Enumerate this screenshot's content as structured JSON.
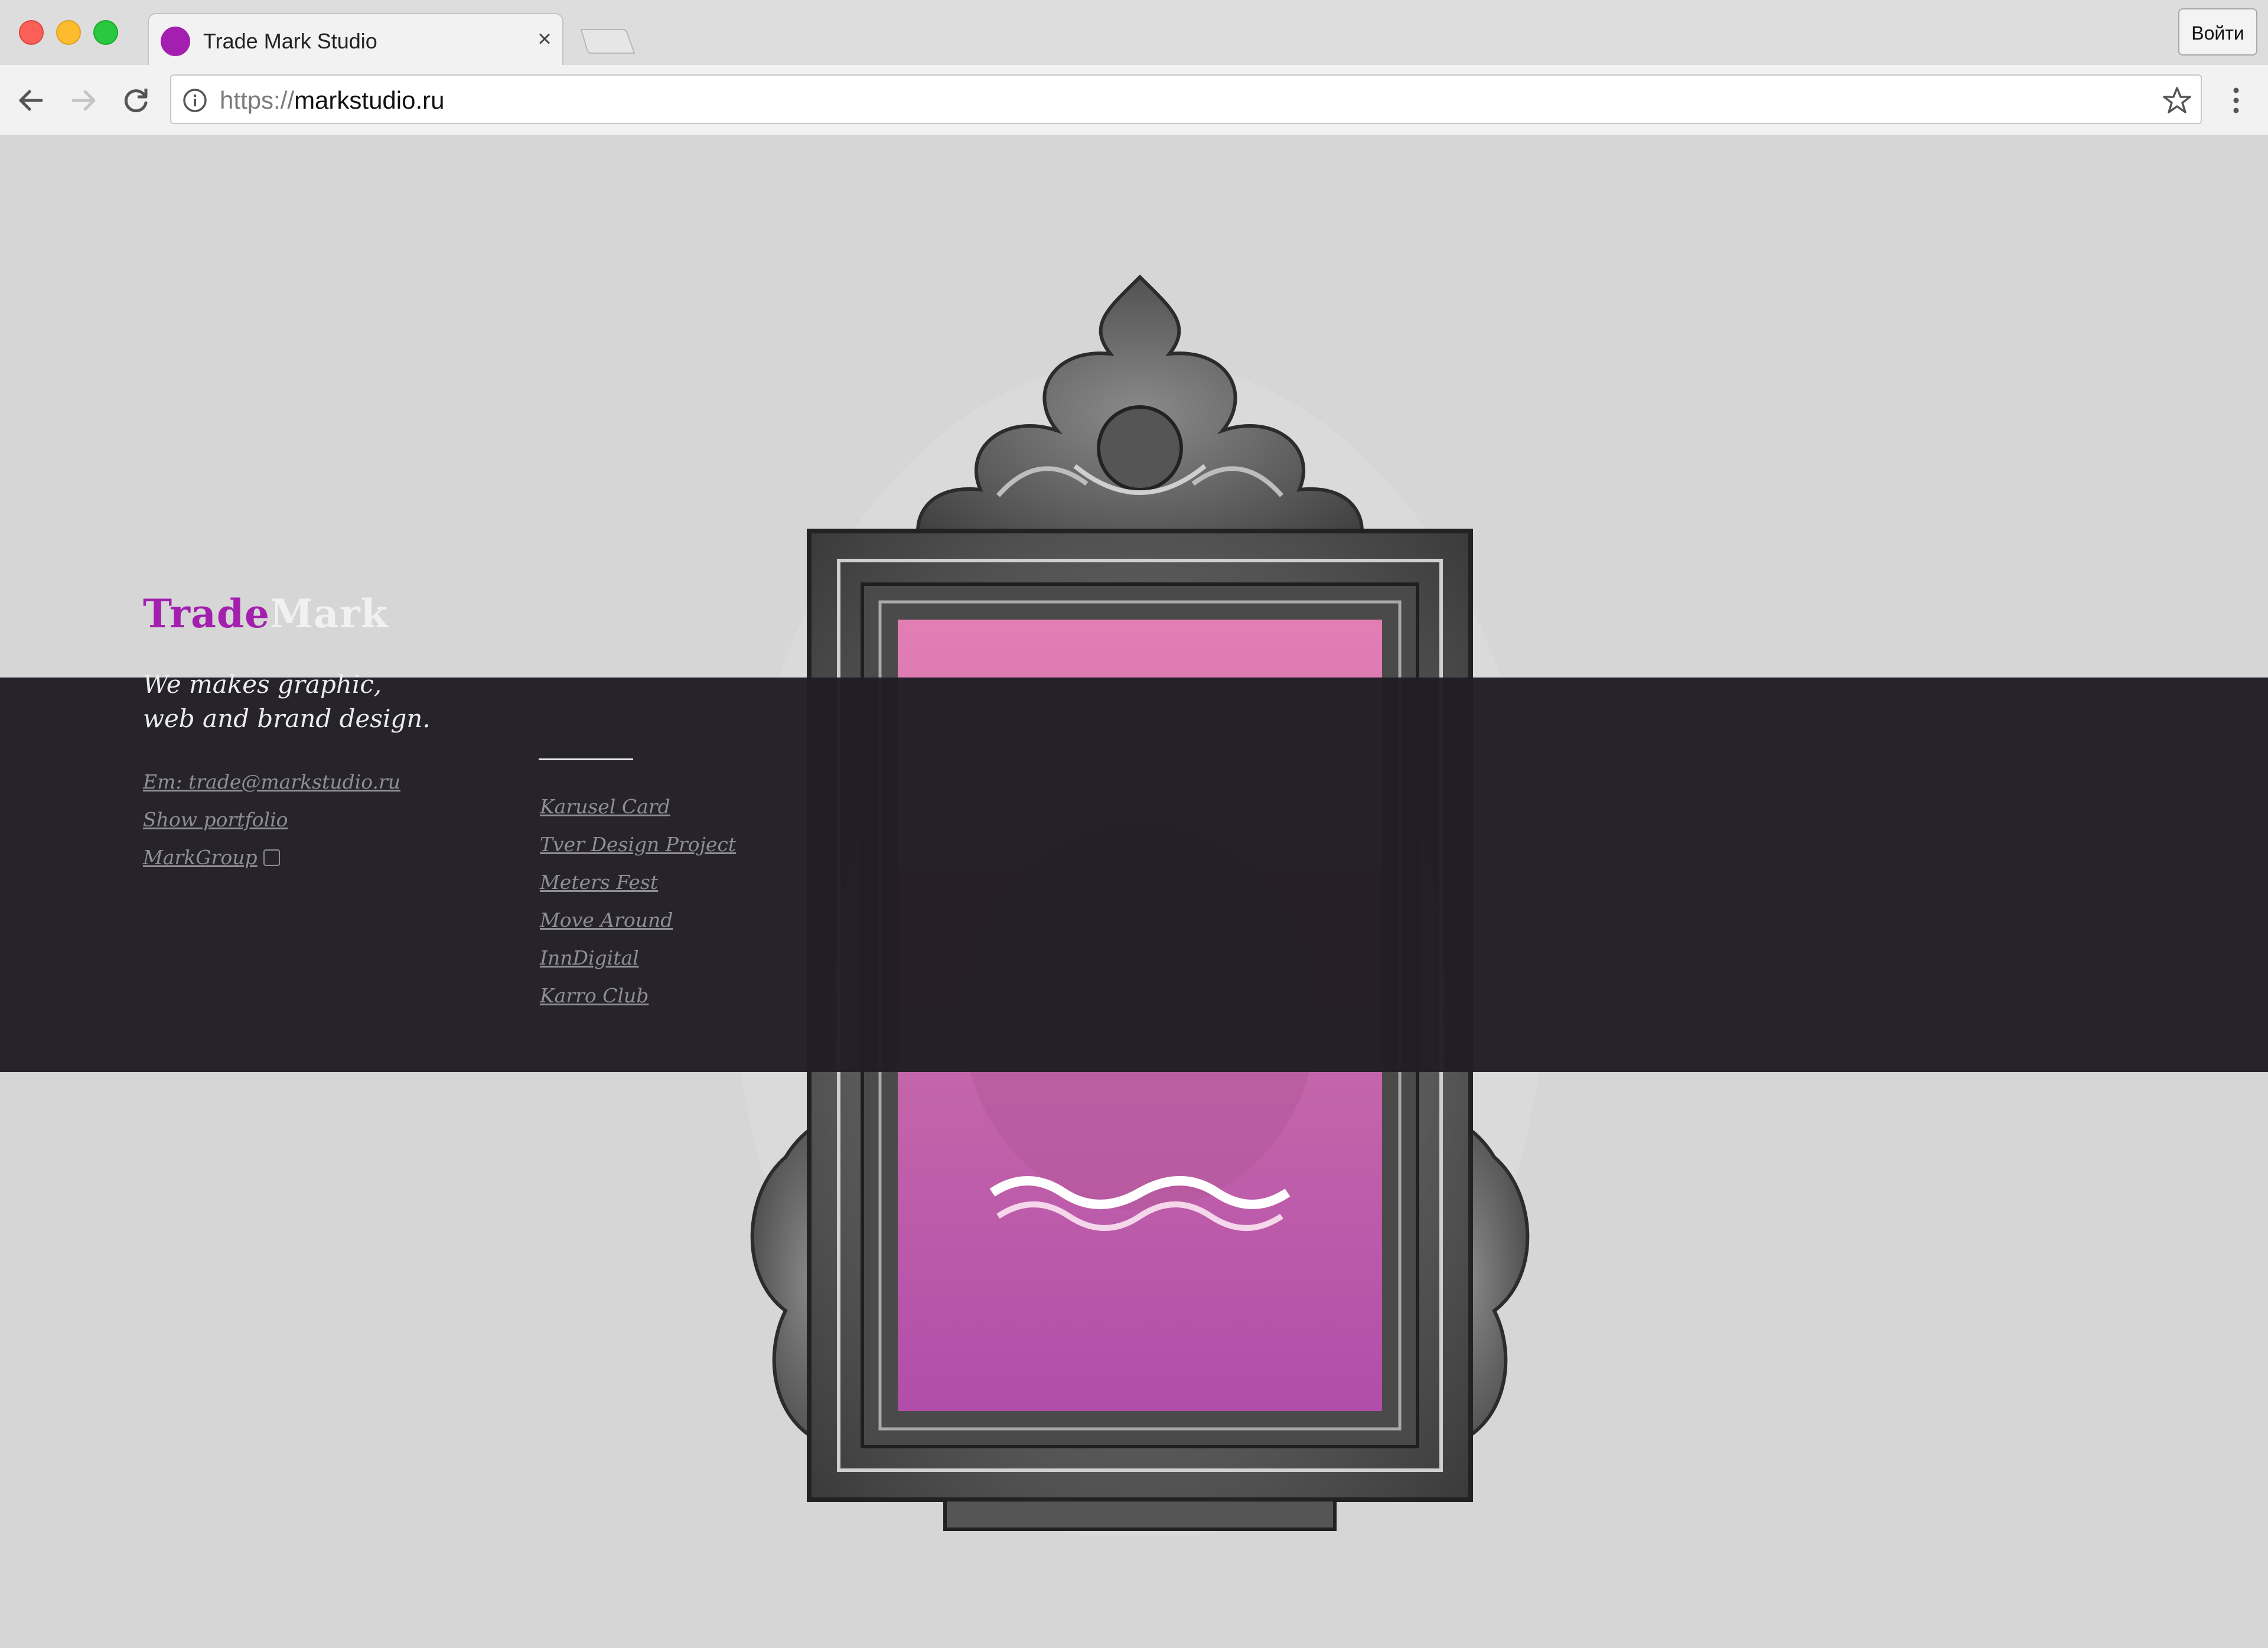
{
  "browser": {
    "tab_title": "Trade Mark Studio",
    "tab_close": "×",
    "signin_label": "Войти",
    "url_scheme": "https://",
    "url_host": "markstudio.ru",
    "favicon_color": "#a41eaf"
  },
  "site": {
    "logo_trade": "Trade",
    "logo_mark": "Mark",
    "tagline_line1": "We makes graphic,",
    "tagline_line2": "web and brand design.",
    "links": {
      "email": "Em: trade@markstudio.ru",
      "portfolio": "Show portfolio",
      "markgroup": "MarkGroup"
    },
    "projects": [
      "Karusel Card",
      "Tver Design Project",
      "Meters Fest",
      "Move Around",
      "InnDigital",
      "Karro Club"
    ],
    "accent_color": "#a220ad",
    "band_color": "#201d25",
    "background_color": "#d6d6d6"
  }
}
